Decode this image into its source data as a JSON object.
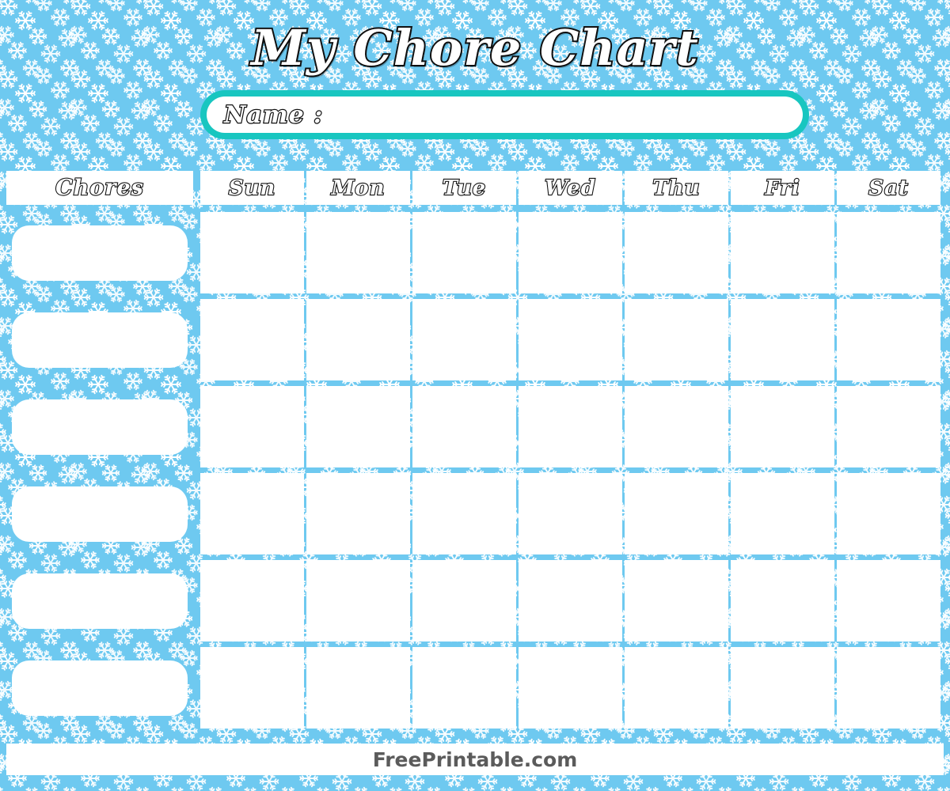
{
  "page": {
    "title": "My Chore Chart",
    "background_color": "#6ec9f0",
    "accent_color": "#18c6c0",
    "pattern": "snowflake-pattern"
  },
  "name_field": {
    "label": "Name :",
    "value": "",
    "placeholder": ""
  },
  "table": {
    "chores_header": "Chores",
    "day_headers": [
      "Sun",
      "Mon",
      "Tue",
      "Wed",
      "Thu",
      "Fri",
      "Sat"
    ],
    "chore_rows": [
      {
        "label": ""
      },
      {
        "label": ""
      },
      {
        "label": ""
      },
      {
        "label": ""
      },
      {
        "label": ""
      },
      {
        "label": ""
      }
    ],
    "row_count": 6,
    "column_count": 7,
    "cells": [
      [
        "",
        "",
        "",
        "",
        "",
        "",
        ""
      ],
      [
        "",
        "",
        "",
        "",
        "",
        "",
        ""
      ],
      [
        "",
        "",
        "",
        "",
        "",
        "",
        ""
      ],
      [
        "",
        "",
        "",
        "",
        "",
        "",
        ""
      ],
      [
        "",
        "",
        "",
        "",
        "",
        "",
        ""
      ],
      [
        "",
        "",
        "",
        "",
        "",
        "",
        ""
      ]
    ]
  },
  "footer": {
    "text": "FreePrintable.com"
  }
}
